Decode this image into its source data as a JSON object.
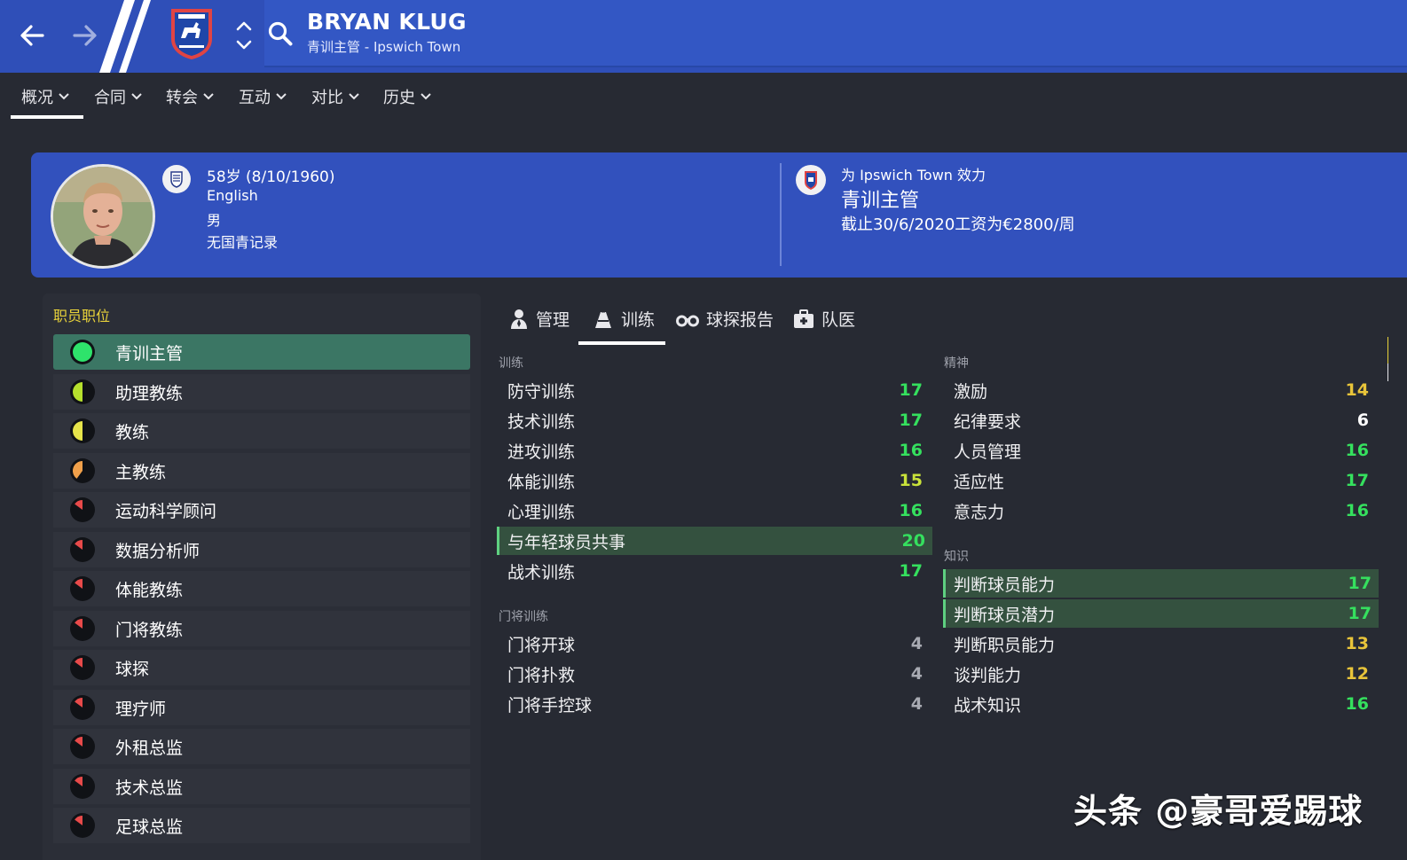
{
  "header": {
    "name": "BRYAN KLUG",
    "subtitle": "青训主管 - Ipswich Town"
  },
  "tabs": [
    {
      "label": "概况"
    },
    {
      "label": "合同"
    },
    {
      "label": "转会"
    },
    {
      "label": "互动"
    },
    {
      "label": "对比"
    },
    {
      "label": "历史"
    }
  ],
  "profile": {
    "age_line": "58岁 (8/10/1960)",
    "nationality": "English",
    "gender": "男",
    "youth_record": "无国青记录"
  },
  "club": {
    "line1": "为 Ipswich Town 效力",
    "role": "青训主管",
    "contract": "截止30/6/2020工资为€2800/周"
  },
  "roles_panel": {
    "title": "职员职位",
    "items": [
      {
        "label": "青训主管",
        "color": "#2ee36b",
        "fill": 1.0
      },
      {
        "label": "助理教练",
        "color": "#b6e02d",
        "fill": 0.5
      },
      {
        "label": "教练",
        "color": "#e6e44a",
        "fill": 0.5
      },
      {
        "label": "主教练",
        "color": "#f0a04a",
        "fill": 0.4
      },
      {
        "label": "运动科学顾问",
        "color": "#e84a4a",
        "fill": 0.15
      },
      {
        "label": "数据分析师",
        "color": "#e84a4a",
        "fill": 0.15
      },
      {
        "label": "体能教练",
        "color": "#e84a4a",
        "fill": 0.15
      },
      {
        "label": "门将教练",
        "color": "#e84a4a",
        "fill": 0.15
      },
      {
        "label": "球探",
        "color": "#e84a4a",
        "fill": 0.15
      },
      {
        "label": "理疗师",
        "color": "#e84a4a",
        "fill": 0.15
      },
      {
        "label": "外租总监",
        "color": "#e84a4a",
        "fill": 0.15
      },
      {
        "label": "技术总监",
        "color": "#e84a4a",
        "fill": 0.15
      },
      {
        "label": "足球总监",
        "color": "#e84a4a",
        "fill": 0.15
      }
    ]
  },
  "sub_tabs": [
    {
      "label": "管理",
      "icon": "manager-icon"
    },
    {
      "label": "训练",
      "icon": "training-icon"
    },
    {
      "label": "球探报告",
      "icon": "binoculars-icon"
    },
    {
      "label": "队医",
      "icon": "medical-kit-icon"
    }
  ],
  "training": {
    "title": "训练",
    "items": [
      {
        "name": "防守训练",
        "value": "17"
      },
      {
        "name": "技术训练",
        "value": "17"
      },
      {
        "name": "进攻训练",
        "value": "16"
      },
      {
        "name": "体能训练",
        "value": "15"
      },
      {
        "name": "心理训练",
        "value": "16"
      },
      {
        "name": "与年轻球员共事",
        "value": "20"
      },
      {
        "name": "战术训练",
        "value": "17"
      }
    ]
  },
  "goalkeeping": {
    "title": "门将训练",
    "items": [
      {
        "name": "门将开球",
        "value": "4"
      },
      {
        "name": "门将扑救",
        "value": "4"
      },
      {
        "name": "门将手控球",
        "value": "4"
      }
    ]
  },
  "mental": {
    "title": "精神",
    "items": [
      {
        "name": "激励",
        "value": "14"
      },
      {
        "name": "纪律要求",
        "value": "6"
      },
      {
        "name": "人员管理",
        "value": "16"
      },
      {
        "name": "适应性",
        "value": "17"
      },
      {
        "name": "意志力",
        "value": "16"
      }
    ]
  },
  "knowledge": {
    "title": "知识",
    "items": [
      {
        "name": "判断球员能力",
        "value": "17"
      },
      {
        "name": "判断球员潜力",
        "value": "17"
      },
      {
        "name": "判断职员能力",
        "value": "13"
      },
      {
        "name": "谈判能力",
        "value": "12"
      },
      {
        "name": "战术知识",
        "value": "16"
      }
    ]
  },
  "value_colors": {
    "high": "#35e05e",
    "good": "#c9e23a",
    "mid": "#e8c43a",
    "low": "#ffffff",
    "gray": "#a8aab2"
  },
  "watermark": "头条 @豪哥爱踢球"
}
